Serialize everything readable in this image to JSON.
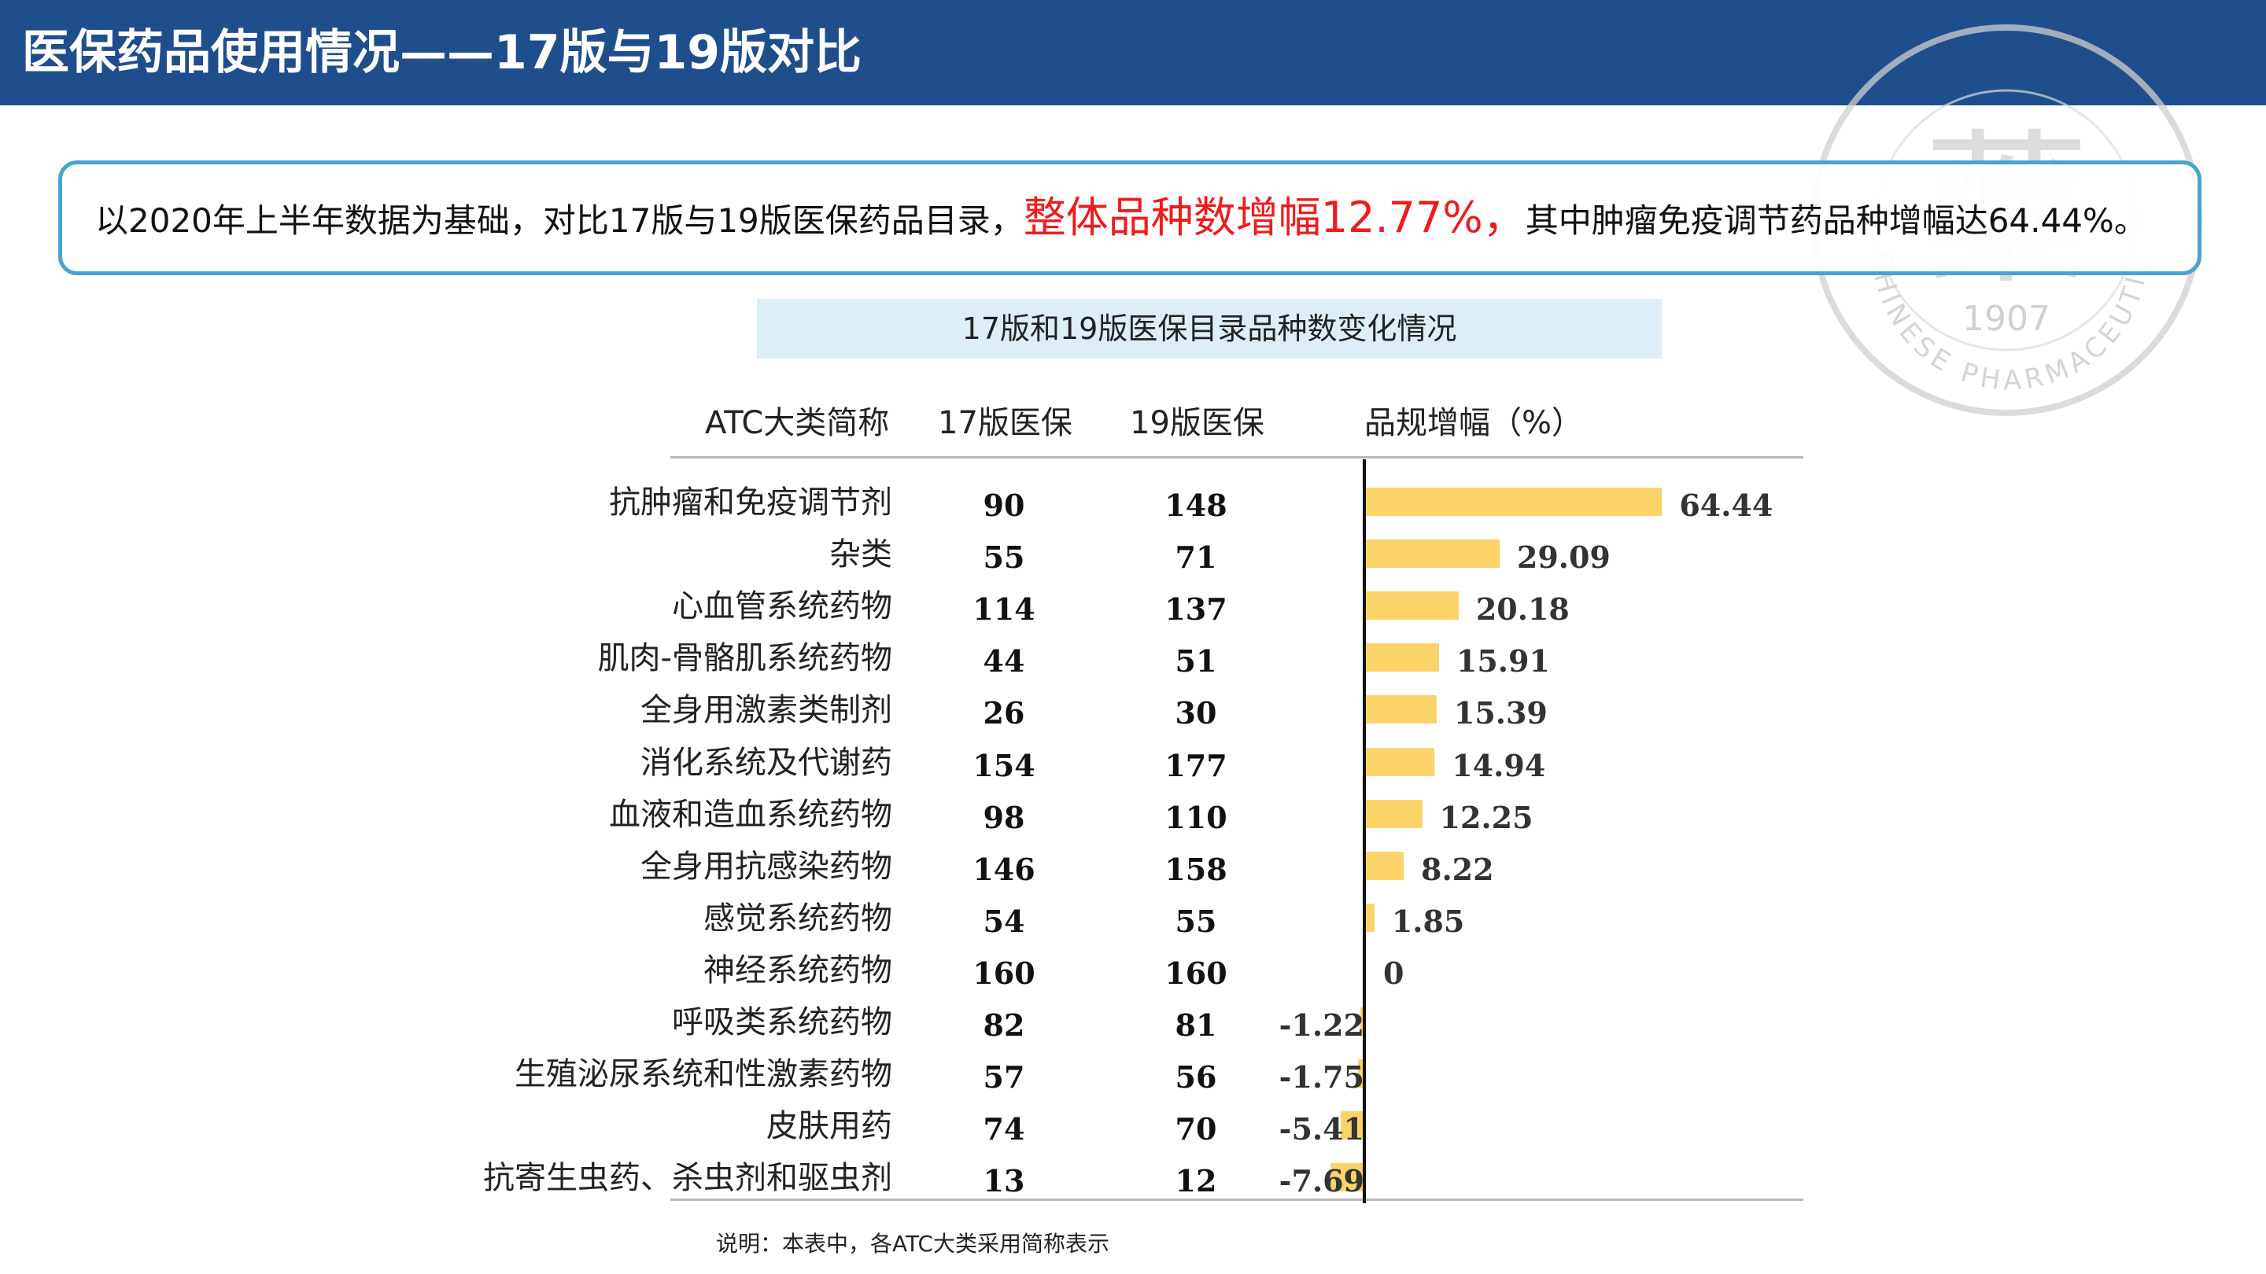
{
  "header": {
    "title": "医保药品使用情况——17版与19版对比"
  },
  "callout": {
    "before": "以2020年上半年数据为基础，对比17版与19版医保药品目录，",
    "highlight": "整体品种数增幅12.77%，",
    "after": "其中肿瘤免疫调节药品种增幅达64.44%。"
  },
  "seal": {
    "char": "藥",
    "year": "1907",
    "ring_text": "CHINESE PHARMACEUTICAL ASSOCIATION"
  },
  "table": {
    "title": "17版和19版医保目录品种数变化情况",
    "columns": [
      "ATC大类简称",
      "17版医保",
      "19版医保",
      "品规增幅（%）"
    ]
  },
  "chart_data": {
    "type": "bar",
    "orientation": "horizontal",
    "title": "17版和19版医保目录品种数变化情况",
    "categories": [
      "抗肿瘤和免疫调节剂",
      "杂类",
      "心血管系统药物",
      "肌肉-骨骼肌系统药物",
      "全身用激素类制剂",
      "消化系统及代谢药",
      "血液和造血系统药物",
      "全身用抗感染药物",
      "感觉系统药物",
      "神经系统药物",
      "呼吸类系统药物",
      "生殖泌尿系统和性激素药物",
      "皮肤用药",
      "抗寄生虫药、杀虫剂和驱虫剂"
    ],
    "v17": [
      90,
      55,
      114,
      44,
      26,
      154,
      98,
      146,
      54,
      160,
      82,
      57,
      74,
      13
    ],
    "v19": [
      148,
      71,
      137,
      51,
      30,
      177,
      110,
      158,
      55,
      160,
      81,
      56,
      70,
      12
    ],
    "values": [
      64.44,
      29.09,
      20.18,
      15.91,
      15.39,
      14.94,
      12.25,
      8.22,
      1.85,
      0,
      -1.22,
      -1.75,
      -5.41,
      -7.69
    ],
    "labels": [
      "64.44",
      "29.09",
      "20.18",
      "15.91",
      "15.39",
      "14.94",
      "12.25",
      "8.22",
      "1.85",
      "0",
      "-1.22",
      "-1.75",
      "-5.41",
      "-7.69"
    ],
    "bar_color": "#fad369",
    "ylabel": "品规增幅（%）"
  },
  "note": "说明：本表中，各ATC大类采用简称表示"
}
